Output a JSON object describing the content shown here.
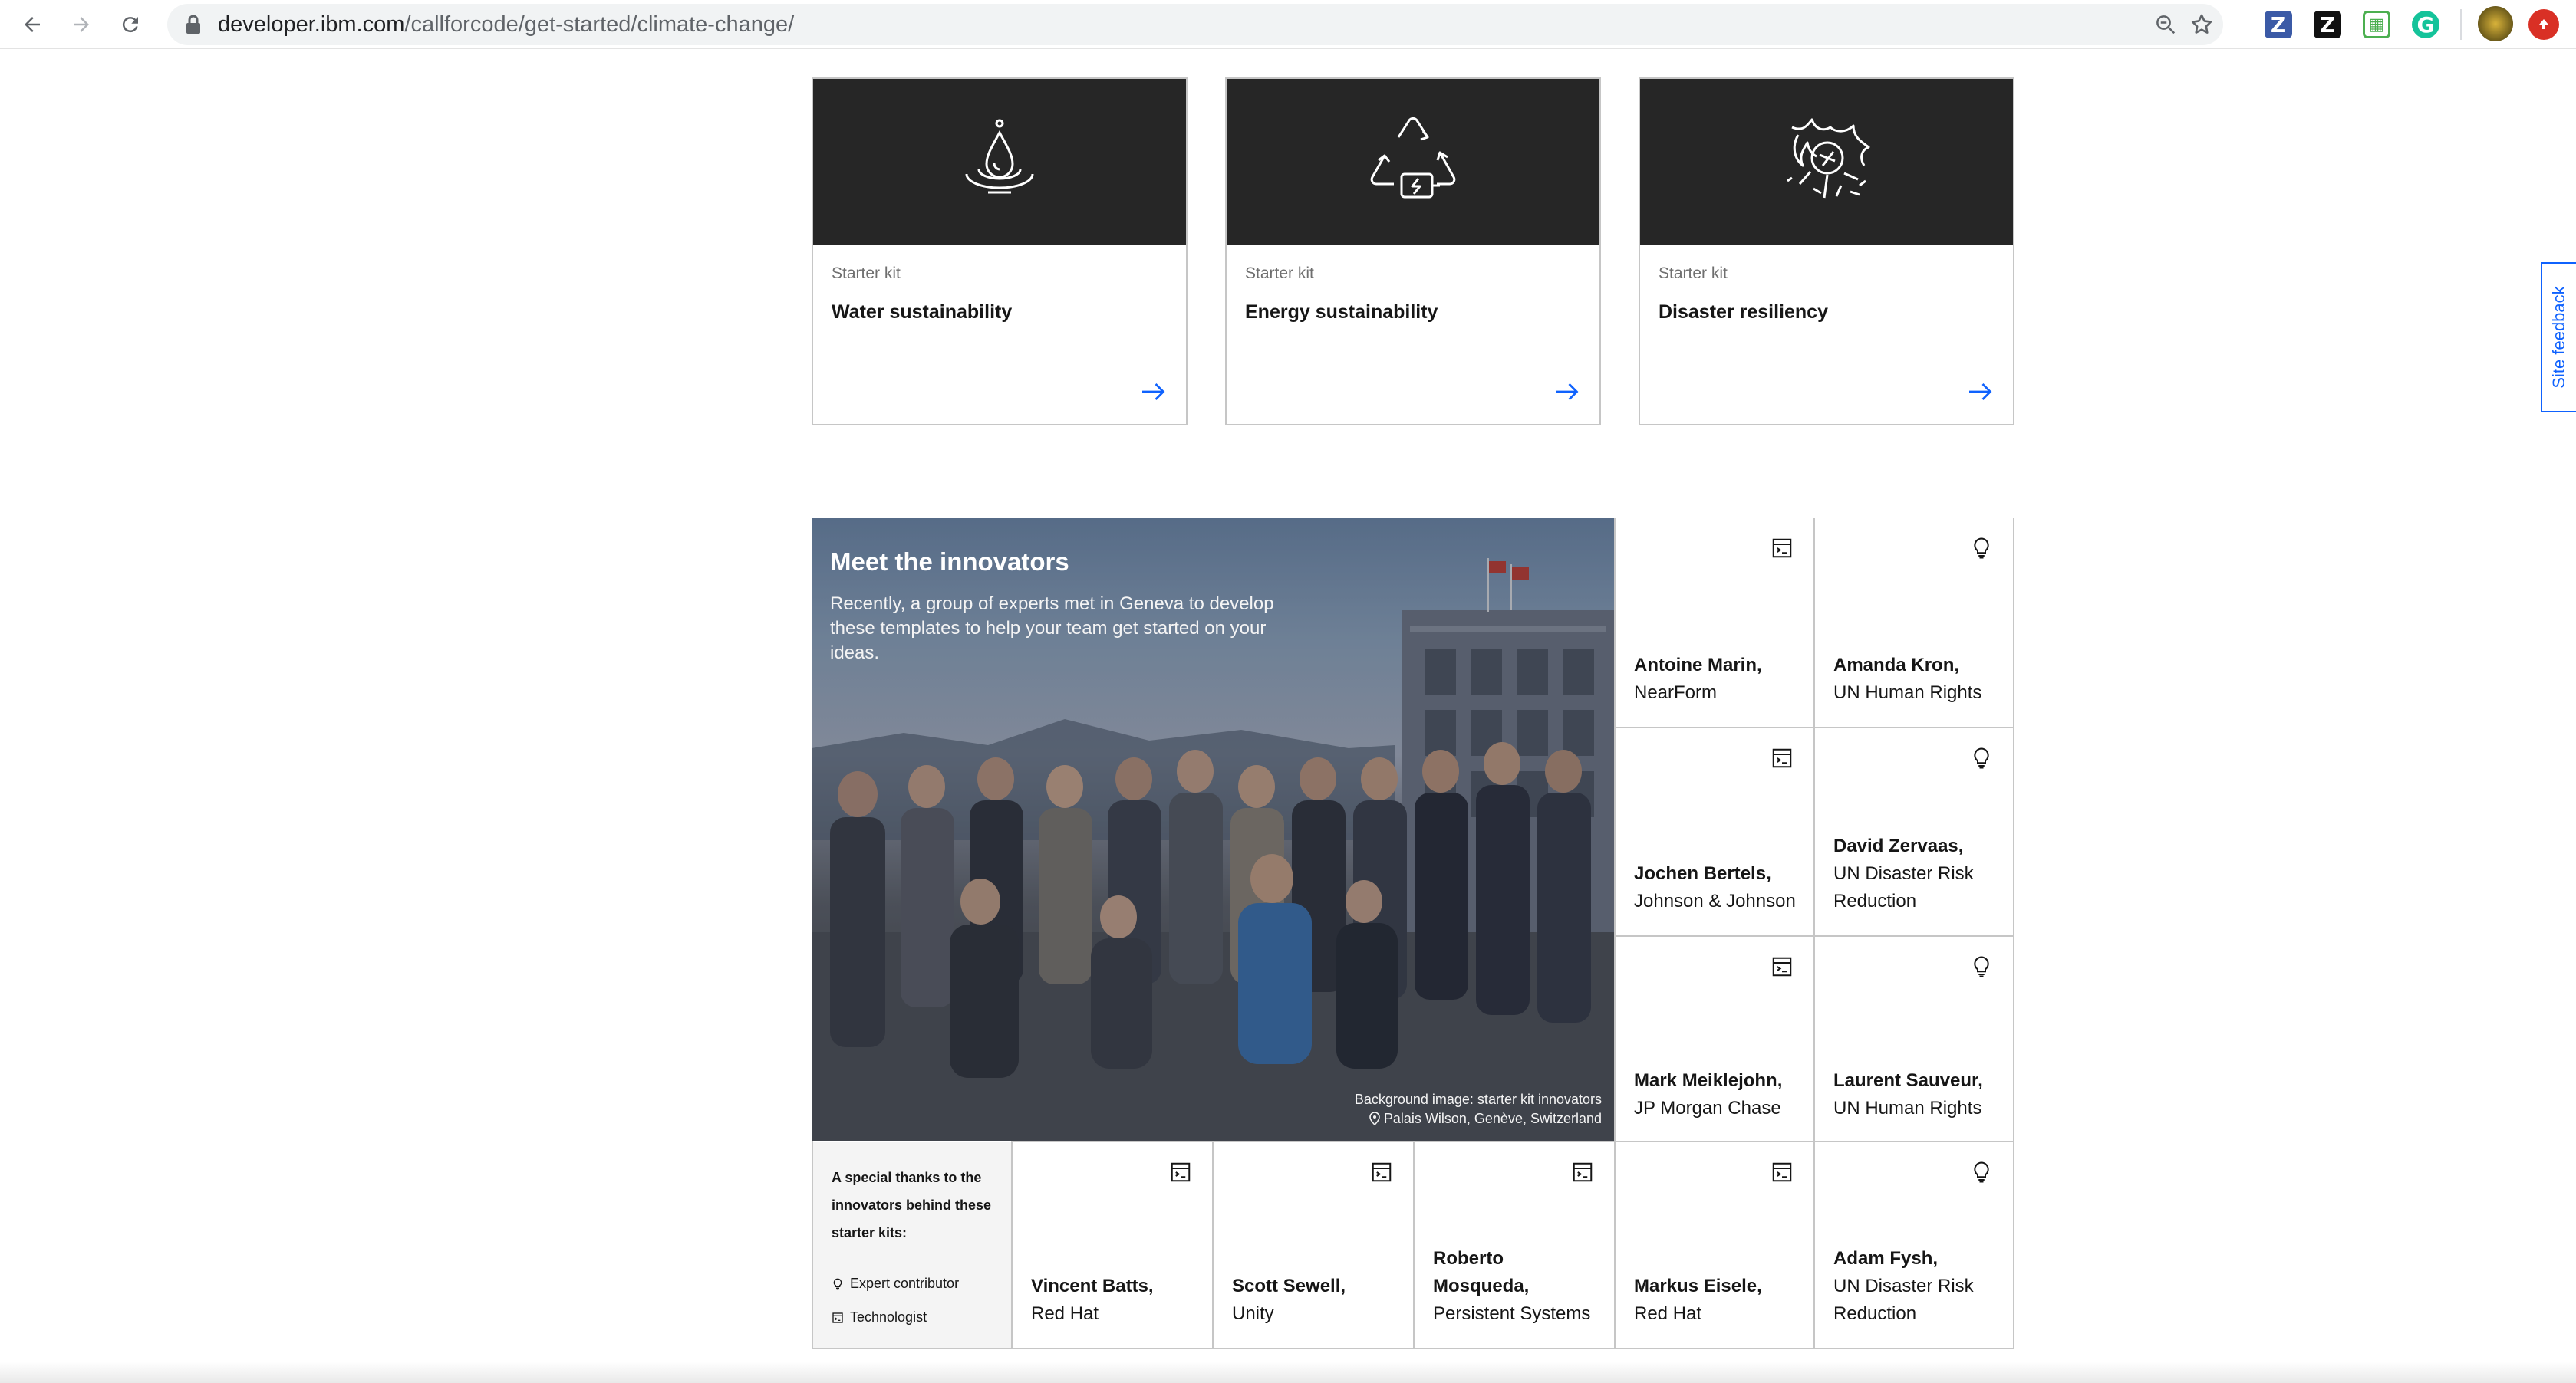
{
  "browser": {
    "url_domain": "developer.ibm.com",
    "url_path": "/callforcode/get-started/climate-change/",
    "icons": [
      "back-icon",
      "forward-icon",
      "reload-icon",
      "lock-icon",
      "zoom-icon",
      "star-icon"
    ],
    "extensions": [
      {
        "name": "zotero-extension",
        "glyph": "Z",
        "color": "#3b5aa6"
      },
      {
        "name": "zotero-connector-extension",
        "glyph": "Z",
        "color": "#111111"
      },
      {
        "name": "green-extension",
        "glyph": "▦",
        "color": "#4caf50"
      },
      {
        "name": "grammarly-extension",
        "glyph": "G",
        "color": "#15c39a"
      }
    ]
  },
  "cards": [
    {
      "kit": "Starter kit",
      "title": "Water sustainability",
      "icon": "water-drop-icon"
    },
    {
      "kit": "Starter kit",
      "title": "Energy sustainability",
      "icon": "recycle-energy-icon"
    },
    {
      "kit": "Starter kit",
      "title": "Disaster resiliency",
      "icon": "fire-hazard-icon"
    }
  ],
  "innovators_section": {
    "heading": "Meet the innovators",
    "description": "Recently, a group of experts met in Geneva to develop these templates to help your team get started on your ideas.",
    "credit_line1": "Background image: starter kit innovators",
    "credit_line2": "Palais Wilson, Genève, Switzerland",
    "thanks": "A special thanks to the innovators behind these starter kits:",
    "legend_expert": "Expert contributor",
    "legend_technologist": "Technologist"
  },
  "people": [
    {
      "name": "Antoine Marin,",
      "org": "NearForm",
      "role": "technologist"
    },
    {
      "name": "Amanda Kron,",
      "org": "UN Human Rights",
      "role": "expert"
    },
    {
      "name": "Jochen Bertels,",
      "org": "Johnson & Johnson",
      "role": "technologist"
    },
    {
      "name": "David Zervaas,",
      "org": "UN Disaster Risk Reduction",
      "role": "expert"
    },
    {
      "name": "Mark Meiklejohn,",
      "org": "JP Morgan Chase",
      "role": "technologist"
    },
    {
      "name": "Laurent Sauveur,",
      "org": "UN Human Rights",
      "role": "expert"
    },
    {
      "name": "Vincent Batts,",
      "org": "Red Hat",
      "role": "technologist"
    },
    {
      "name": "Scott Sewell,",
      "org": "Unity",
      "role": "technologist"
    },
    {
      "name": "Roberto Mosqueda,",
      "org": "Persistent Systems",
      "role": "technologist"
    },
    {
      "name": "Markus Eisele,",
      "org": "Red Hat",
      "role": "technologist"
    },
    {
      "name": "Adam Fysh,",
      "org": "UN Disaster Risk Reduction",
      "role": "expert"
    }
  ],
  "site_feedback": "Site feedback",
  "colors": {
    "accent": "#0f62fe",
    "dark": "#262626",
    "border": "#c6c6c6"
  }
}
